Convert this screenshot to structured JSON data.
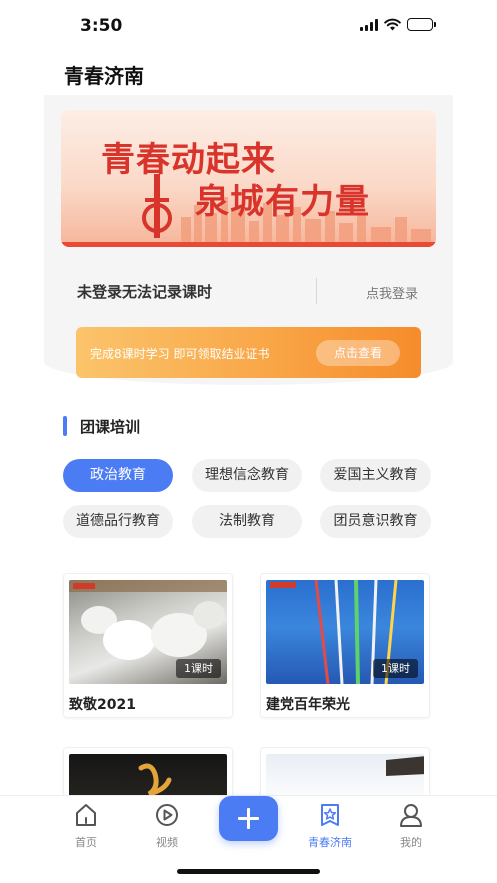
{
  "status_bar": {
    "time": "3:50"
  },
  "header": {
    "title": "青春济南"
  },
  "banner": {
    "line1": "青春动起来",
    "line2": "泉城有力量",
    "colors": {
      "text": "#d9342b",
      "background": "#fbd9c8"
    }
  },
  "login": {
    "text": "未登录无法记录课时",
    "button": "点我登录"
  },
  "certificate": {
    "text": "完成8课时学习  即可领取结业证书",
    "button": "点击查看"
  },
  "section": {
    "title": "团课培训"
  },
  "categories": [
    {
      "label": "政治教育",
      "selected": true
    },
    {
      "label": "理想信念教育",
      "selected": false
    },
    {
      "label": "爱国主义教育",
      "selected": false
    },
    {
      "label": "道德品行教育",
      "selected": false
    },
    {
      "label": "法制教育",
      "selected": false
    },
    {
      "label": "团员意识教育",
      "selected": false
    }
  ],
  "courses": [
    {
      "title": "致敬2021",
      "hours": "1课时"
    },
    {
      "title": "建党百年荣光",
      "hours": "1课时"
    },
    {
      "title": "",
      "hours": ""
    },
    {
      "title": "",
      "hours": ""
    }
  ],
  "tabbar": {
    "items": [
      {
        "label": "首页",
        "icon": "home-icon"
      },
      {
        "label": "视频",
        "icon": "play-icon"
      },
      {
        "label": "",
        "icon": "plus-icon"
      },
      {
        "label": "青春济南",
        "icon": "star-bookmark-icon",
        "active": true
      },
      {
        "label": "我的",
        "icon": "user-icon"
      }
    ]
  },
  "colors": {
    "accent": "#4c7cf3",
    "orange": "#f68c2b"
  }
}
